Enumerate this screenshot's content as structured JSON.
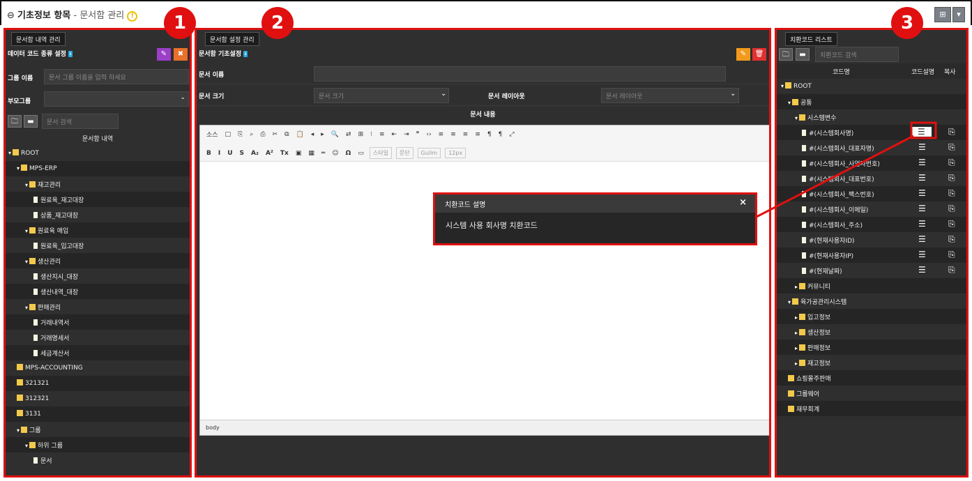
{
  "header": {
    "title_main": "기초정보 항목",
    "title_sep": " - ",
    "title_sub": "문서함 관리",
    "warn": "!",
    "grid_btn": "⊞",
    "dd_btn": "▾"
  },
  "callouts": [
    "1",
    "2",
    "3"
  ],
  "left": {
    "tab": "문서함 내역 관리",
    "section": "데이터 코드 종류 설정",
    "group_name_label": "그룹 이름",
    "group_name_placeholder": "문서 그룹 이름을 입력 하세요",
    "parent_group_label": "부모그룹",
    "search_placeholder": "문서 검색",
    "tree_title": "문서함 내역",
    "tree": [
      {
        "label": "ROOT",
        "level": 0,
        "type": "folder",
        "caret": "▾"
      },
      {
        "label": "MPS-ERP",
        "level": 1,
        "type": "folder",
        "caret": "▾"
      },
      {
        "label": "재고관리",
        "level": 2,
        "type": "folder",
        "caret": "▾"
      },
      {
        "label": "원료육_재고대장",
        "level": 3,
        "type": "file"
      },
      {
        "label": "상품_재고대장",
        "level": 3,
        "type": "file"
      },
      {
        "label": "원료육 매입",
        "level": 2,
        "type": "folder",
        "caret": "▾"
      },
      {
        "label": "원료육_입고대장",
        "level": 3,
        "type": "file"
      },
      {
        "label": "생산관리",
        "level": 2,
        "type": "folder",
        "caret": "▾"
      },
      {
        "label": "생산지시_대장",
        "level": 3,
        "type": "file"
      },
      {
        "label": "생산내역_대장",
        "level": 3,
        "type": "file"
      },
      {
        "label": "판매관리",
        "level": 2,
        "type": "folder",
        "caret": "▾"
      },
      {
        "label": "거래내역서",
        "level": 3,
        "type": "file"
      },
      {
        "label": "거래명세서",
        "level": 3,
        "type": "file"
      },
      {
        "label": "세금계산서",
        "level": 3,
        "type": "file"
      },
      {
        "label": "MPS-ACCOUNTING",
        "level": 1,
        "type": "folder"
      },
      {
        "label": "321321",
        "level": 1,
        "type": "folder"
      },
      {
        "label": "312321",
        "level": 1,
        "type": "folder"
      },
      {
        "label": "3131",
        "level": 1,
        "type": "folder"
      },
      {
        "label": "그룹",
        "level": 1,
        "type": "folder",
        "caret": "▾"
      },
      {
        "label": "하위 그룹",
        "level": 2,
        "type": "folder",
        "caret": "▾"
      },
      {
        "label": "문서",
        "level": 3,
        "type": "file"
      }
    ]
  },
  "center": {
    "tab": "문서함 설정 관리",
    "section": "문서함 기초설정",
    "doc_name_label": "문서 이름",
    "doc_size_label": "문서 크기",
    "doc_size_placeholder": "문서 크기",
    "doc_layout_label": "문서 레이아웃",
    "doc_layout_placeholder": "문서 레이아웃",
    "doc_content_label": "문서 내용",
    "toolbar1": [
      "소스",
      "□",
      "⎘",
      "⌕",
      "⎙",
      "✂",
      "⧉",
      "📋",
      "◂",
      "▸",
      "🔍",
      "⇄",
      "⊞",
      "⁝",
      "≡",
      "⇤",
      "⇥",
      "❞",
      "‹›",
      "≡",
      "≡",
      "≡",
      "≡",
      "¶",
      "¶",
      "⤢"
    ],
    "toolbar2_fmt": [
      "B",
      "I",
      "U",
      "S",
      "A₂",
      "A²",
      "Tx",
      "▣",
      "▦",
      "═",
      "☺",
      "Ω",
      "▭"
    ],
    "style_select": "스타일",
    "para_select": "문단",
    "font_select": "Gulim",
    "size_select": "12px",
    "status": "body",
    "popup": {
      "title": "치환코드 설명",
      "close": "×",
      "text": "시스템 사용 회사명 치환코드"
    }
  },
  "right": {
    "tab": "치환코드 리스트",
    "search_placeholder": "치환코드 검색",
    "col_name": "코드명",
    "col_desc": "코드설명",
    "col_copy": "복사",
    "desc_icon": "☰",
    "copy_icon": "⎘",
    "tree": [
      {
        "label": "ROOT",
        "level": 0,
        "type": "folder",
        "caret": "▾"
      },
      {
        "label": "공통",
        "level": 1,
        "type": "folder",
        "caret": "▾"
      },
      {
        "label": "시스템변수",
        "level": 2,
        "type": "folder",
        "caret": "▾"
      },
      {
        "label": "#(시스템회사명)",
        "level": 3,
        "type": "code",
        "sel": true
      },
      {
        "label": "#(시스템회사_대표자명)",
        "level": 3,
        "type": "code"
      },
      {
        "label": "#(시스템회사_사업자번호)",
        "level": 3,
        "type": "code"
      },
      {
        "label": "#(시스템회사_대표번호)",
        "level": 3,
        "type": "code"
      },
      {
        "label": "#(시스템회사_팩스번호)",
        "level": 3,
        "type": "code"
      },
      {
        "label": "#(시스템회사_이메일)",
        "level": 3,
        "type": "code"
      },
      {
        "label": "#(시스템회사_주소)",
        "level": 3,
        "type": "code"
      },
      {
        "label": "#(현재사용자ID)",
        "level": 3,
        "type": "code"
      },
      {
        "label": "#(현재사용자IP)",
        "level": 3,
        "type": "code"
      },
      {
        "label": "#(현재날짜)",
        "level": 3,
        "type": "code"
      },
      {
        "label": "커뮤니티",
        "level": 2,
        "type": "folder",
        "caret": "▸"
      },
      {
        "label": "육가공관리시스템",
        "level": 1,
        "type": "folder",
        "caret": "▾"
      },
      {
        "label": "입고정보",
        "level": 2,
        "type": "folder",
        "caret": "▸"
      },
      {
        "label": "생산정보",
        "level": 2,
        "type": "folder",
        "caret": "▸"
      },
      {
        "label": "판매정보",
        "level": 2,
        "type": "folder",
        "caret": "▸"
      },
      {
        "label": "재고정보",
        "level": 2,
        "type": "folder",
        "caret": "▸"
      },
      {
        "label": "쇼핑몰주판매",
        "level": 1,
        "type": "folder"
      },
      {
        "label": "그룹웨어",
        "level": 1,
        "type": "folder"
      },
      {
        "label": "재무회계",
        "level": 1,
        "type": "folder"
      }
    ]
  }
}
